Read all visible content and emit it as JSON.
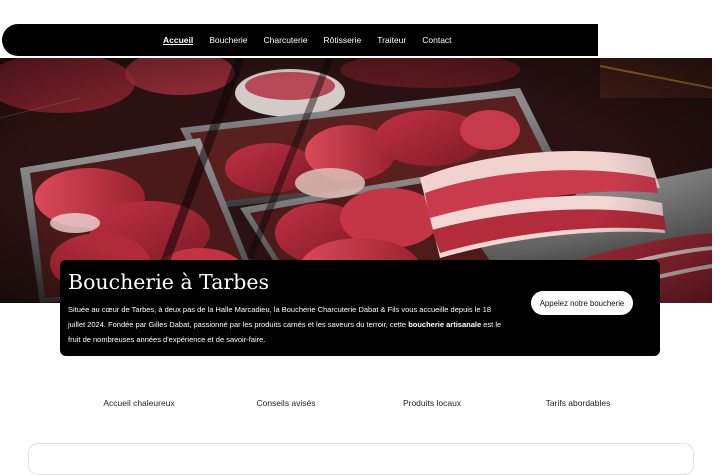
{
  "nav": {
    "items": [
      {
        "label": "Accueil",
        "active": true
      },
      {
        "label": "Boucherie",
        "active": false
      },
      {
        "label": "Charcuterie",
        "active": false
      },
      {
        "label": "Rôtisserie",
        "active": false
      },
      {
        "label": "Traiteur",
        "active": false
      },
      {
        "label": "Contact",
        "active": false
      }
    ]
  },
  "hero": {
    "image_subject": "raw-meat-display-case"
  },
  "intro": {
    "title": "Boucherie à Tarbes",
    "desc_part1": "Située au cœur de Tarbes, à deux pas de la Halle Marcadieu, la Boucherie Charcuterie Dabat & Fils vous accueille depuis le 18 juillet 2024. Fondée par Gilles Dabat, passionné par les produits carnés et les saveurs du terroir, cette ",
    "desc_bold": "boucherie artisanale",
    "desc_part2": " est le fruit de nombreuses années d'expérience et de savoir-faire.",
    "cta_label": "Appelez notre boucherie"
  },
  "features": [
    "Accueil chaleureux",
    "Conseils avisés",
    "Produits locaux",
    "Tarifs abordables"
  ],
  "colors": {
    "nav_bg": "#000000",
    "card_bg": "#000000",
    "meat": "#b0283a",
    "fat": "#f2d6d6"
  }
}
